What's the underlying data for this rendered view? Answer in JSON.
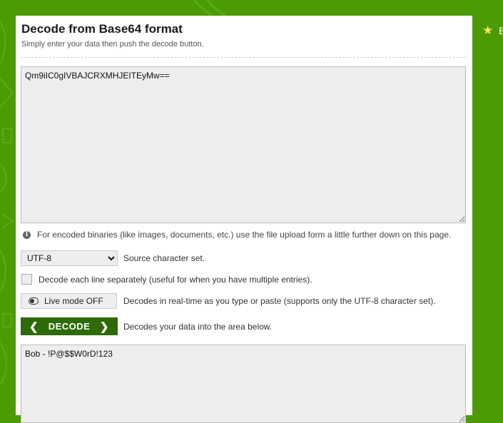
{
  "header": {
    "title": "Decode from Base64 format",
    "subtitle": "Simply enter your data then push the decode button."
  },
  "input": {
    "value": "Qm9iIC0gIVBAJCRXMHJEITEyMw=="
  },
  "info": {
    "text": "For encoded binaries (like images, documents, etc.) use the file upload form a little further down on this page."
  },
  "charset": {
    "selected": "UTF-8",
    "label": "Source character set."
  },
  "lines": {
    "label": "Decode each line separately (useful for when you have multiple entries)."
  },
  "live": {
    "button_label": "Live mode OFF",
    "label": "Decodes in real-time as you type or paste (supports only the UTF-8 character set)."
  },
  "decode": {
    "button_label": "DECODE",
    "label": "Decodes your data into the area below."
  },
  "output": {
    "value": "Bob - !P@$$W0rD!123"
  },
  "side": {
    "text": "B"
  },
  "colors": {
    "brand_green": "#4c9b06",
    "button_green": "#2e6b06"
  }
}
